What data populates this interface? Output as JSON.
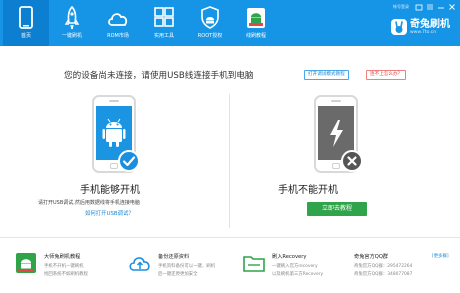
{
  "nav": {
    "items": [
      {
        "label": "首页",
        "icon": "phone-icon"
      },
      {
        "label": "一键刷机",
        "icon": "rocket-icon"
      },
      {
        "label": "ROM市场",
        "icon": "cloud-icon"
      },
      {
        "label": "实用工具",
        "icon": "grid-icon"
      },
      {
        "label": "ROOT授权",
        "icon": "shield-android-icon"
      },
      {
        "label": "线刷教程",
        "icon": "android-guide-icon"
      }
    ],
    "active": "首页",
    "window_text": "帐号登录"
  },
  "brand": {
    "name": "奇兔刷机",
    "site": "www.7to.cn"
  },
  "main": {
    "headline": "您的设备尚未连接，请使用USB线连接手机到电脑",
    "tutorial_button": "打开调试模式教程",
    "help_button": "连不上怎么办？",
    "ok": {
      "title": "手机能够开机",
      "desc": "请打开USB调试,然后用数据线将手机连接电脑",
      "link": "如何打开USB调试？"
    },
    "bad": {
      "title": "手机不能开机",
      "button": "立即去教程"
    }
  },
  "cards": [
    {
      "title": "大师兔刷机教程",
      "d1": "手机不开机一键刷机",
      "d2": "找回系统不如刷机教程"
    },
    {
      "title": "备份还原资料",
      "d1": "手机资料备份可以一键，刷机",
      "d2": "后一键还原更加安全"
    },
    {
      "title": "刷入Recovery",
      "d1": "一键刷入官方recovery",
      "d2": "以及刷机第三方Recovery"
    },
    {
      "title": "奇兔官方QQ群",
      "d1": "奇兔官方QQ群：295472264",
      "d2": "奇兔官方QQ群：348077087",
      "more": "[更多群]"
    }
  ],
  "colors": {
    "toolbar": "#1694e6",
    "toolbar_active": "#0d7fd0",
    "check_badge": "#1a8fe0",
    "cross_badge": "#555555",
    "phone_ok_screen": "#1b94e2",
    "phone_bad_screen": "#6a6a6a",
    "green_button": "#2fa44a",
    "link": "#1a86d4"
  }
}
